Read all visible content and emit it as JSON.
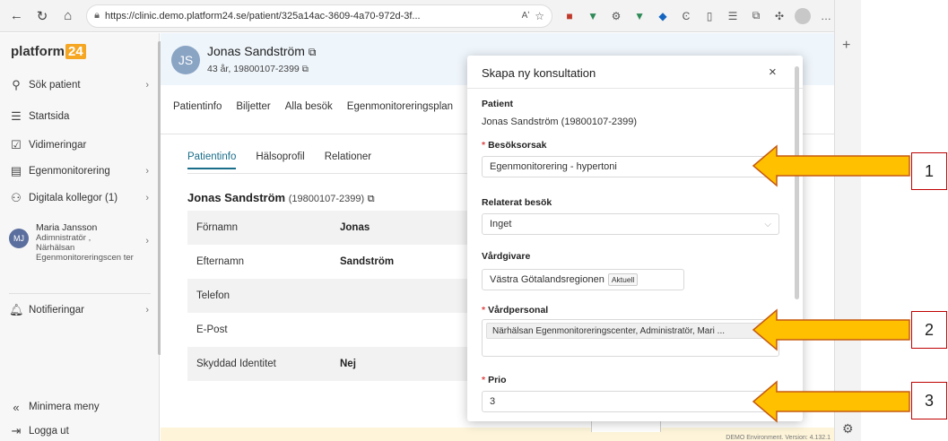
{
  "browser": {
    "url": "https://clinic.demo.platform24.se/patient/325a14ac-3609-4a70-972d-3f...",
    "read_aloud_label": "Aʹ"
  },
  "sidebar": {
    "logo_text": "platform",
    "logo_num": "24",
    "items": [
      {
        "label": "Sök patient",
        "icon": "search-icon"
      },
      {
        "label": "Startsida",
        "icon": "list-icon"
      },
      {
        "label": "Vidimeringar",
        "icon": "checkbox-icon"
      },
      {
        "label": "Egenmonitorering",
        "icon": "monitor-icon"
      },
      {
        "label": "Digitala kollegor (1)",
        "icon": "people-icon"
      }
    ],
    "user": {
      "initials": "MJ",
      "name": "Maria Jansson",
      "role": "Adimnistratör ,",
      "org": "Närhälsan Egenmonitoreringscen ter"
    },
    "notifications_label": "Notifieringar",
    "minimize_label": "Minimera meny",
    "logout_label": "Logga ut"
  },
  "patient": {
    "initials": "JS",
    "name": "Jonas Sandström",
    "meta": "43 år, 19800107-2399",
    "tabs": [
      "Patientinfo",
      "Biljetter",
      "Alla besök",
      "Egenmonitoreringsplan"
    ],
    "subtabs": [
      "Patientinfo",
      "Hälsoprofil",
      "Relationer"
    ],
    "title_name": "Jonas Sandström",
    "title_pn": "(19800107-2399)",
    "fields": [
      {
        "k": "Förnamn",
        "v": "Jonas"
      },
      {
        "k": "Efternamn",
        "v": "Sandström"
      },
      {
        "k": "Telefon",
        "v": ""
      },
      {
        "k": "E-Post",
        "v": ""
      },
      {
        "k": "Skyddad Identitet",
        "v": "Nej"
      }
    ],
    "version_text": "DEMO Environment. Version: 4.132.1"
  },
  "modal": {
    "title": "Skapa ny konsultation",
    "close": "×",
    "patient_label": "Patient",
    "patient_value": "Jonas Sandström (19800107-2399)",
    "reason_label": "Besöksorsak",
    "reason_value": "Egenmonitorering - hypertoni",
    "related_label": "Relaterat besök",
    "related_value": "Inget",
    "caregiver_label": "Vårdgivare",
    "caregiver_value": "Västra Götalandsregionen",
    "caregiver_tag": "Aktuell",
    "staff_label": "Vårdpersonal",
    "staff_value": "Närhälsan Egenmonitoreringscenter, Administratör, Mari ...",
    "prio_label": "Prio",
    "prio_value": "3",
    "required_mark": "*"
  },
  "annotations": {
    "callout_1": "1",
    "callout_2": "2",
    "callout_3": "3",
    "arrow_color": "#ffc000",
    "arrow_border": "#c55a11",
    "callout_border": "#c00000"
  }
}
